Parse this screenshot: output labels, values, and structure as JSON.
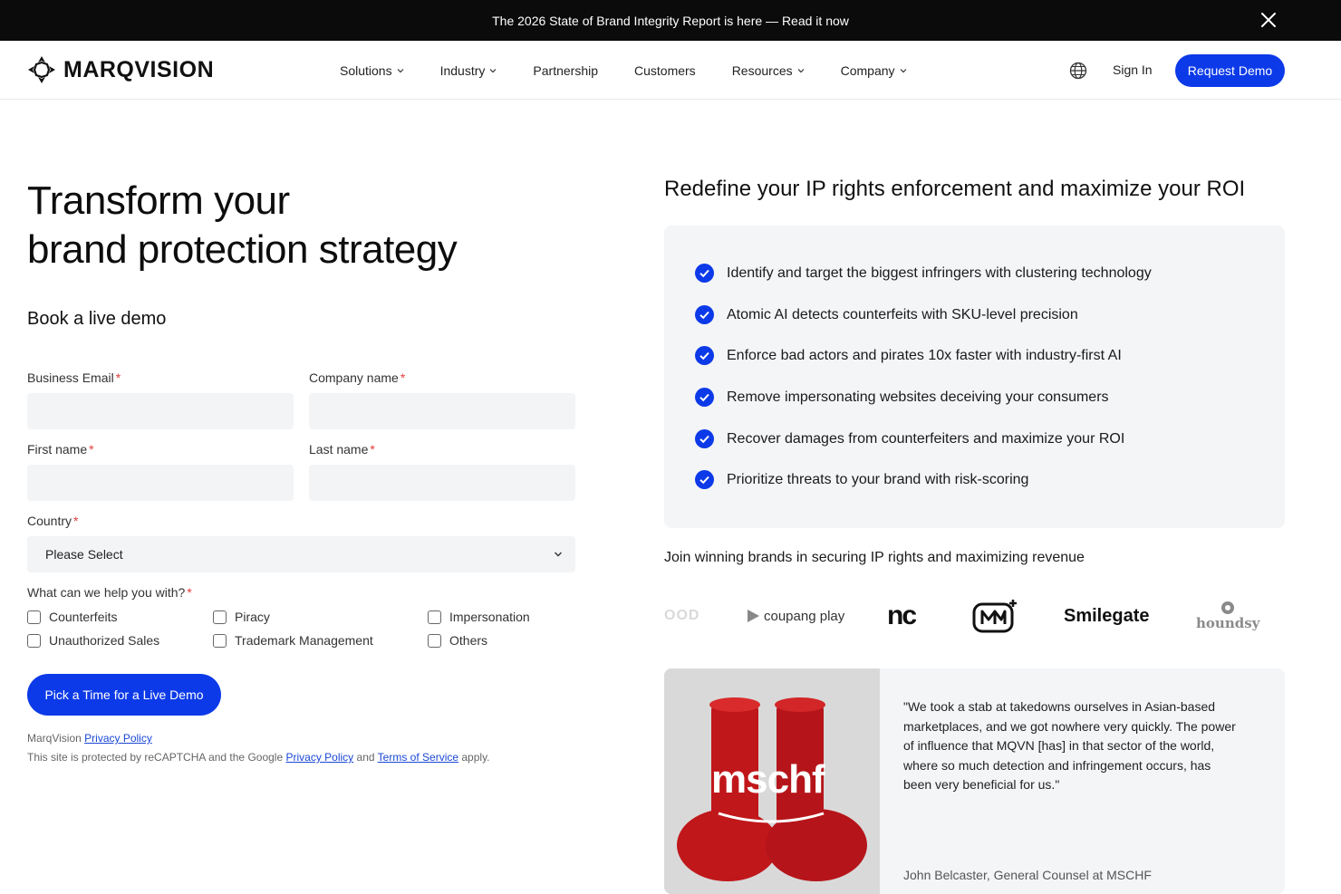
{
  "announcement": {
    "text": "The 2026 State of Brand Integrity Report is here — Read it now",
    "close_icon": "close-icon"
  },
  "header": {
    "logo_text": "MARQVISION",
    "nav": [
      {
        "label": "Solutions",
        "has_dropdown": true
      },
      {
        "label": "Industry",
        "has_dropdown": true
      },
      {
        "label": "Partnership",
        "has_dropdown": false
      },
      {
        "label": "Customers",
        "has_dropdown": false
      },
      {
        "label": "Resources",
        "has_dropdown": true
      },
      {
        "label": "Company",
        "has_dropdown": true
      }
    ],
    "globe_icon": "globe-icon",
    "sign_in": "Sign In",
    "request_demo": "Request Demo"
  },
  "hero": {
    "title_line1": "Transform your",
    "title_line2": "brand protection strategy",
    "book_label": "Book a live demo"
  },
  "form": {
    "business_email_label": "Business Email",
    "company_name_label": "Company name",
    "first_name_label": "First name",
    "last_name_label": "Last name",
    "country_label": "Country",
    "country_value": "Please Select",
    "required_mark": "*",
    "help_label": "What can we help you with?",
    "options": [
      "Counterfeits",
      "Piracy",
      "Impersonation",
      "Unauthorized Sales",
      "Trademark Management",
      "Others"
    ],
    "submit_label": "Pick a Time for a Live Demo",
    "fine1_prefix": "MarqVision",
    "fine1_link": "Privacy Policy",
    "fine2_prefix": "This site is protected by reCAPTCHA and the Google",
    "fine2_link1": "Privacy Policy",
    "fine2_and": "and",
    "fine2_link2": "Terms of Service",
    "fine2_suffix": "apply."
  },
  "benefits": {
    "title": "Redefine your IP rights enforcement and maximize your ROI",
    "items": [
      "Identify and target the biggest infringers with clustering technology",
      "Atomic AI detects counterfeits with SKU-level precision",
      "Enforce bad actors and pirates 10x faster with industry-first AI",
      "Remove impersonating websites deceiving your consumers",
      "Recover damages from counterfeiters and maximize your ROI",
      "Prioritize threats to your brand with risk-scoring"
    ]
  },
  "brands": {
    "heading": "Join winning brands in securing IP rights and maximizing revenue",
    "logos": [
      "OOD",
      "coupang play",
      "nc",
      "M+",
      "Smilegate",
      "houndsy"
    ]
  },
  "testimonial": {
    "image_text": "mschf",
    "quote": "\"We took a stab at takedowns ourselves in Asian-based marketplaces, and we got nowhere very quickly. The power of influence that MQVN [has] in that sector of the world, where so much detection and infringement occurs, has been very beneficial for us.\"",
    "author": "John Belcaster, General Counsel at MSCHF"
  },
  "colors": {
    "accent": "#0c3ae8",
    "announce_bg": "#0b0b0b",
    "panel_bg": "#f4f5f7",
    "required": "#e43b3b"
  }
}
